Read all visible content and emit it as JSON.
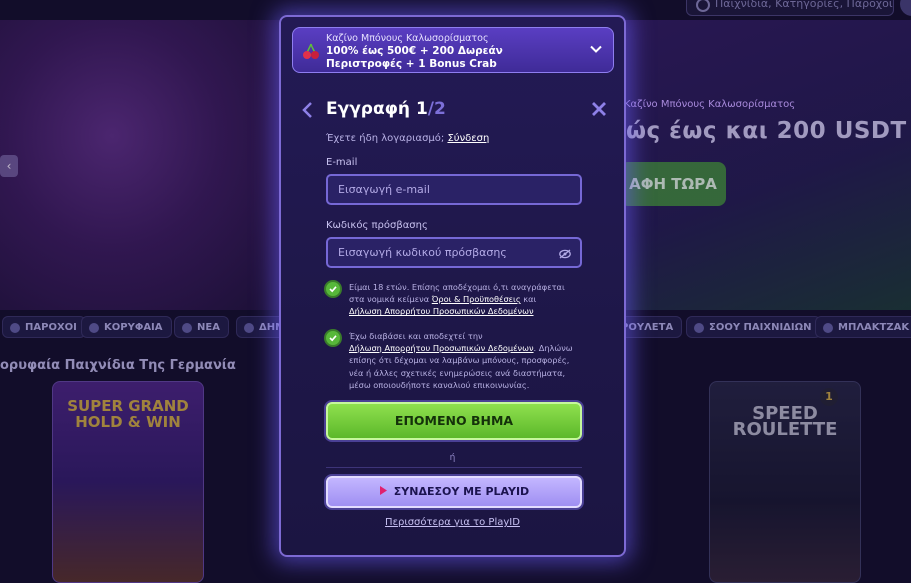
{
  "background": {
    "search_placeholder": "Παιχνίδια, Κατηγορίες, Πάροχοι",
    "banner_tag": "Καζίνο Μπόνους Καλωσορίσματος",
    "banner_title": "ώς έως και 200 USDT",
    "banner_button": "ΑΦΗ ΤΩΡΑ",
    "nav_pills": [
      "ΠΑΡΟΧΟΙ",
      "ΚΟΡΥΦΑΙΑ",
      "ΝΕΑ",
      "ΔΗΜ",
      "ΡΟΥΛΕΤΑ",
      "ΣΟΟΥ ΠΑΙΧΝΙΔΙΩΝ",
      "ΜΠΛΑΚΤΖΑΚ"
    ],
    "section_title": "ορυφαία Παιχνίδια Της Γερμανία",
    "card_left_title": "SUPER GRAND HOLD & WIN",
    "card_right_title": "SPEED ROULETTE",
    "card_right_badge": "1"
  },
  "modal": {
    "bonus": {
      "subtitle": "Καζίνο Μπόνους Καλωσορίσματος",
      "title": "100% έως 500€ + 200 Δωρεάν Περιστροφές + 1 Bonus Crab"
    },
    "header": {
      "title": "Εγγραφή 1",
      "step": "/2"
    },
    "have_account": {
      "text": "Έχετε ήδη λογαριασμό; ",
      "link": "Σύνδεση"
    },
    "email": {
      "label": "E-mail",
      "placeholder": "Εισαγωγή e-mail"
    },
    "password": {
      "label": "Κωδικός πρόσβασης",
      "placeholder": "Εισαγωγή κωδικού πρόσβασης"
    },
    "consent_terms": {
      "text_before": "Είμαι 18 ετών. Επίσης αποδέχομαι ό,τι αναγράφεται στα νομικά κείμενα ",
      "link_terms": "Όροι & Προϋποθέσεις",
      "text_mid": " και ",
      "link_privacy": "Δήλωση Απορρήτου Προσωπικών Δεδομένων"
    },
    "consent_marketing": {
      "text_before": "Έχω διαβάσει και αποδεχτεί την ",
      "link_privacy": "Δήλωση Απορρήτου Προσωπικών Δεδομένων",
      "text_after": ". Δηλώνω επίσης ότι δέχομαι να λαμβάνω μπόνους, προσφορές, νέα ή άλλες σχετικές ενημερώσεις ανά διαστήματα, μέσω οποιουδήποτε καναλιού επικοινωνίας."
    },
    "next_button": "ΕΠΟΜΕΝΟ ΒΗΜΑ",
    "or_text": "ή",
    "playid_button": "ΣΥΝΔΕΣΟΥ ΜΕ PLAYID",
    "more_link": "Περισσότερα για το PlayID"
  },
  "colors": {
    "accent": "#7d6ad4",
    "primary_button": "#6cc83a",
    "secondary_button": "#b2a4fb",
    "modal_bg": "#211a50"
  }
}
